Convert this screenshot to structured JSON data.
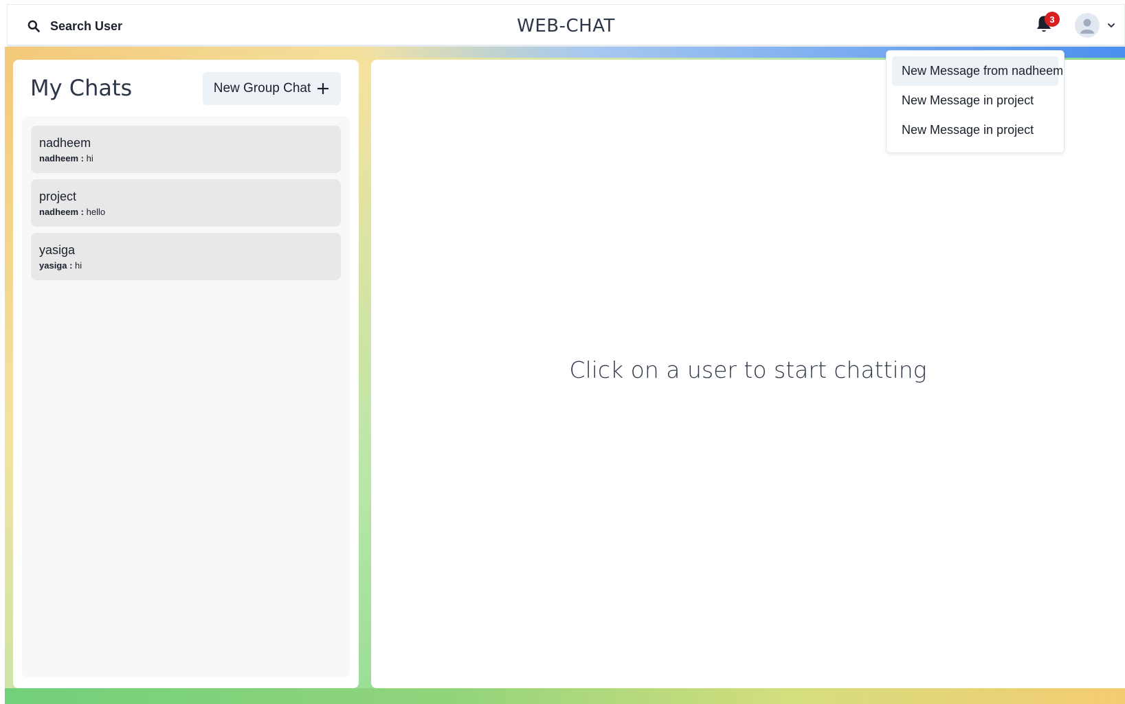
{
  "header": {
    "search_label": "Search User",
    "app_title": "WEB-CHAT",
    "notification_count": "3"
  },
  "sidebar": {
    "title": "My Chats",
    "new_group_label": "New Group Chat",
    "chats": [
      {
        "name": "nadheem",
        "sender": "nadheem :",
        "message": "hi"
      },
      {
        "name": "project",
        "sender": "nadheem :",
        "message": "hello"
      },
      {
        "name": "yasiga",
        "sender": "yasiga :",
        "message": "hi"
      }
    ]
  },
  "chat_box": {
    "placeholder": "Click on a user to start chatting"
  },
  "notifications": {
    "items": [
      {
        "label": "New Message from nadheem"
      },
      {
        "label": "New Message in project"
      },
      {
        "label": "New Message in project"
      }
    ]
  },
  "colors": {
    "badge": "#d81f1f",
    "panel_bg": "#ffffff",
    "chat_item_bg": "#e8e8e8",
    "button_bg": "#edf2f7"
  }
}
